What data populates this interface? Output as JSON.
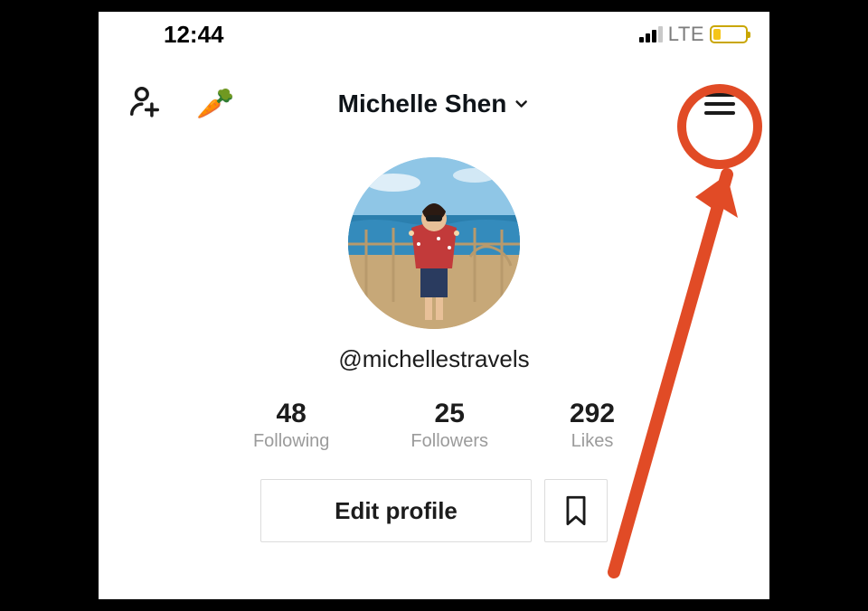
{
  "status": {
    "time": "12:44",
    "network": "LTE"
  },
  "header": {
    "display_name": "Michelle Shen"
  },
  "profile": {
    "handle": "@michellestravels"
  },
  "stats": {
    "following": {
      "value": "48",
      "label": "Following"
    },
    "followers": {
      "value": "25",
      "label": "Followers"
    },
    "likes": {
      "value": "292",
      "label": "Likes"
    }
  },
  "buttons": {
    "edit_profile": "Edit profile"
  },
  "annotation": {
    "color": "#e14b26"
  }
}
